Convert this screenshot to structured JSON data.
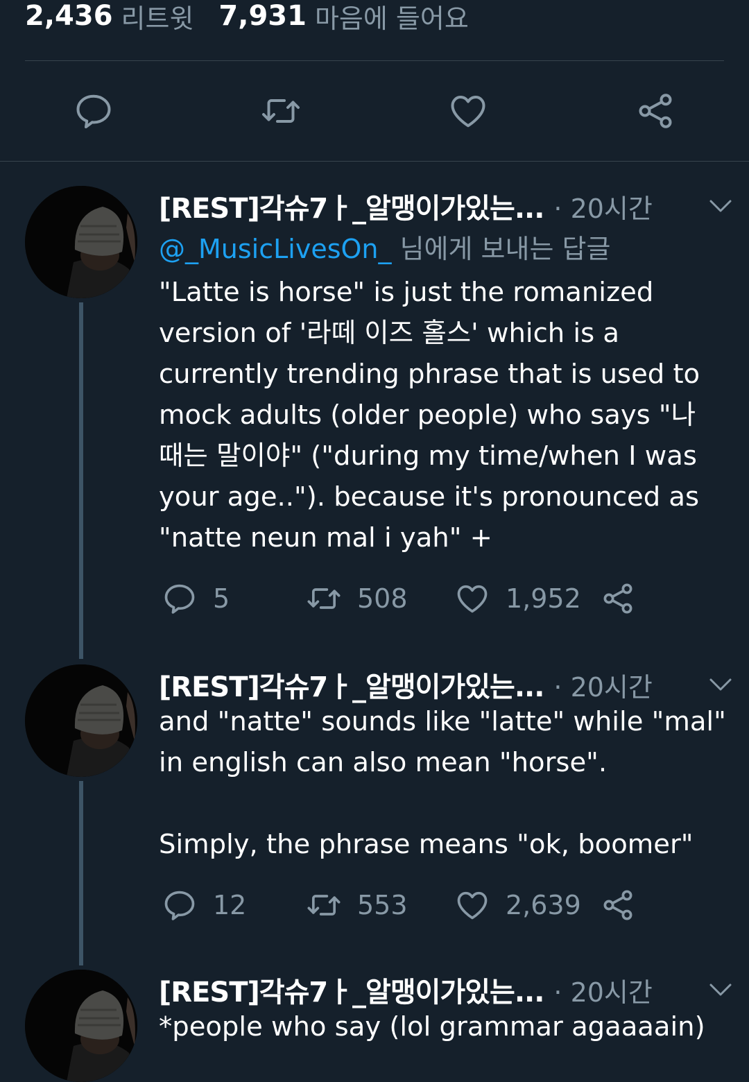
{
  "stats": {
    "retweets_count": "2,436",
    "retweets_label": "리트윗",
    "likes_count": "7,931",
    "likes_label": "마음에 들어요"
  },
  "main_actions": {
    "icons": [
      "reply-icon",
      "retweet-icon",
      "like-icon",
      "share-icon"
    ]
  },
  "colors": {
    "background": "#15202b",
    "text": "#ffffff",
    "secondary": "#8899a6",
    "link": "#1da1f2",
    "divider": "#38444d",
    "thread_line": "#3d5466"
  },
  "tweets": [
    {
      "name": "[REST]각슈7ㅏ_알맹이가있는...",
      "time": "· 20시간",
      "reply_to_handle": "@_MusicLivesOn_",
      "reply_to_suffix": " 님에게 보내는 답글",
      "text": "\"Latte is horse\" is just the romanized\nversion of '라떼 이즈 홀스' which is a\ncurrently trending phrase that is used to\nmock adults (older people) who says \"나\n때는 말이야\" (\"during my time/when I was\nyour age..\"). because it's pronounced as\n\"natte neun mal i yah\" +",
      "replies": "5",
      "retweets": "508",
      "likes": "1,952"
    },
    {
      "name": "[REST]각슈7ㅏ_알맹이가있는...",
      "time": "· 20시간",
      "text": "and \"natte\" sounds like \"latte\" while \"mal\"\nin english can also mean \"horse\".\n\nSimply, the phrase means \"ok, boomer\"",
      "replies": "12",
      "retweets": "553",
      "likes": "2,639"
    },
    {
      "name": "[REST]각슈7ㅏ_알맹이가있는...",
      "time": "· 20시간",
      "text": "*people who say (lol grammar agaaaain)"
    }
  ]
}
